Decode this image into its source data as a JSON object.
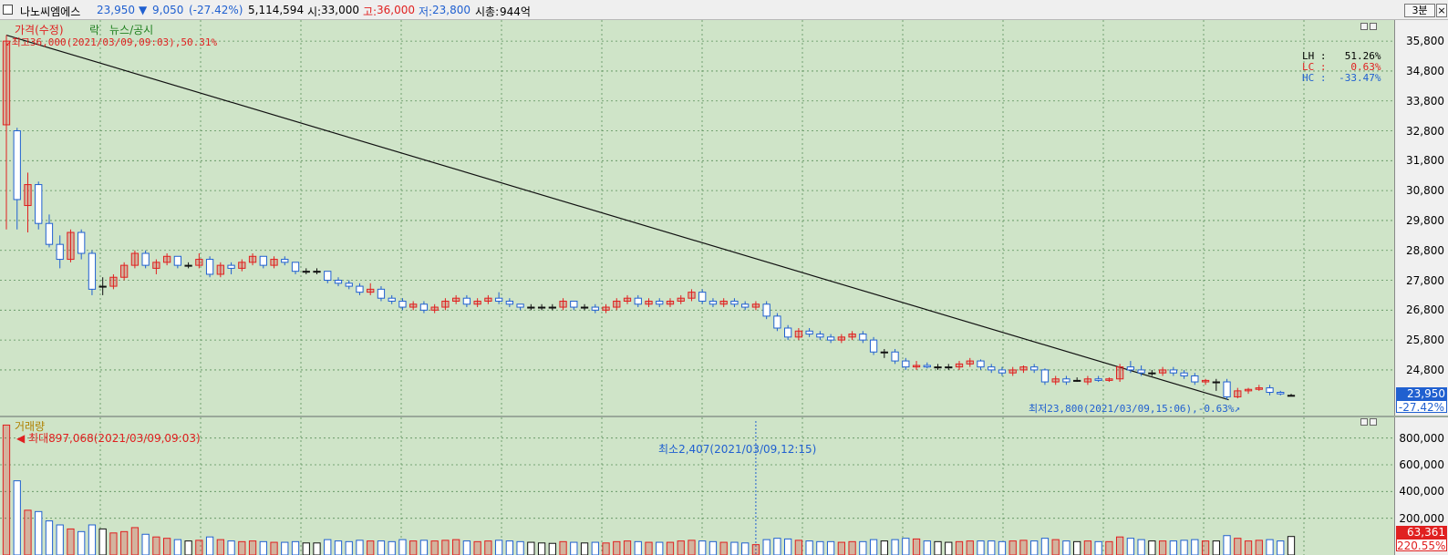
{
  "header": {
    "stock_name": "나노씨엠에스",
    "price": "23,950",
    "change_arrow": "▼",
    "change": "9,050",
    "change_pct": "(-27.42%)",
    "volume": "5,114,594",
    "open_label": "시:",
    "open": "33,000",
    "high_label": "고:",
    "high": "36,000",
    "low_label": "저:",
    "low": "23,800",
    "mcap_label": "시총:",
    "mcap": "944억",
    "period_button": "3분",
    "close_button": "×",
    "color_up": "#e02020",
    "color_down": "#2060d0"
  },
  "price_pane": {
    "legend": [
      "가격(수정)",
      "락",
      "뉴스/공시"
    ],
    "max_annotation": "최고36,000(2021/03/09,09:03),50.31%",
    "min_annotation": "최저23,800(2021/03/09,15:06),-0.63%",
    "stats": {
      "lh_label": "LH :",
      "lh_value": "51.26%",
      "lc_label": "LC :",
      "lc_value": "0.63%",
      "hc_label": "HC :",
      "hc_value": "-33.47%"
    },
    "axis_ticks": [
      "35,800",
      "34,800",
      "33,800",
      "32,800",
      "31,800",
      "30,800",
      "29,800",
      "28,800",
      "27,800",
      "26,800",
      "25,800",
      "24,800"
    ],
    "current_price_badge": "23,950",
    "current_pct_badge": "-27.42%"
  },
  "volume_pane": {
    "legend": "거래량",
    "max_annotation": "최대897,068(2021/03/09,09:03)",
    "min_annotation": "최소2,407(2021/03/09,12:15)",
    "axis_ticks": [
      "800,000",
      "600,000",
      "400,000",
      "200,000"
    ],
    "current_volume_badge": "63,361",
    "badge_pct": "220.55%"
  },
  "chart_data": {
    "type": "candlestick",
    "interval": "3분",
    "y_range": [
      23700,
      36200
    ],
    "volume_range": [
      0,
      900000
    ],
    "candles": [
      {
        "o": 33000,
        "h": 36000,
        "l": 29500,
        "c": 35800,
        "v": 897068
      },
      {
        "o": 32800,
        "h": 32900,
        "l": 29500,
        "c": 30500,
        "v": 480000
      },
      {
        "o": 30300,
        "h": 31400,
        "l": 29400,
        "c": 31000,
        "v": 260000
      },
      {
        "o": 31000,
        "h": 31100,
        "l": 29500,
        "c": 29700,
        "v": 250000
      },
      {
        "o": 29700,
        "h": 30000,
        "l": 28900,
        "c": 29000,
        "v": 180000
      },
      {
        "o": 29000,
        "h": 29300,
        "l": 28200,
        "c": 28500,
        "v": 150000
      },
      {
        "o": 28500,
        "h": 29500,
        "l": 28400,
        "c": 29400,
        "v": 120000
      },
      {
        "o": 29400,
        "h": 29500,
        "l": 28500,
        "c": 28700,
        "v": 100000
      },
      {
        "o": 28700,
        "h": 28800,
        "l": 27300,
        "c": 27500,
        "v": 150000
      },
      {
        "o": 27600,
        "h": 27900,
        "l": 27300,
        "c": 27600,
        "v": 120000
      },
      {
        "o": 27600,
        "h": 28000,
        "l": 27500,
        "c": 27900,
        "v": 90000
      },
      {
        "o": 27900,
        "h": 28400,
        "l": 27800,
        "c": 28300,
        "v": 100000
      },
      {
        "o": 28300,
        "h": 28800,
        "l": 28200,
        "c": 28700,
        "v": 130000
      },
      {
        "o": 28700,
        "h": 28800,
        "l": 28200,
        "c": 28300,
        "v": 80000
      },
      {
        "o": 28200,
        "h": 28500,
        "l": 28000,
        "c": 28400,
        "v": 60000
      },
      {
        "o": 28400,
        "h": 28700,
        "l": 28300,
        "c": 28600,
        "v": 50000
      },
      {
        "o": 28600,
        "h": 28600,
        "l": 28200,
        "c": 28300,
        "v": 40000
      },
      {
        "o": 28300,
        "h": 28400,
        "l": 28200,
        "c": 28300,
        "v": 30000
      },
      {
        "o": 28300,
        "h": 28700,
        "l": 28200,
        "c": 28500,
        "v": 35000
      },
      {
        "o": 28500,
        "h": 28600,
        "l": 27900,
        "c": 28000,
        "v": 60000
      },
      {
        "o": 28000,
        "h": 28400,
        "l": 27900,
        "c": 28300,
        "v": 40000
      },
      {
        "o": 28300,
        "h": 28400,
        "l": 28000,
        "c": 28200,
        "v": 30000
      },
      {
        "o": 28200,
        "h": 28500,
        "l": 28100,
        "c": 28400,
        "v": 25000
      },
      {
        "o": 28400,
        "h": 28700,
        "l": 28300,
        "c": 28600,
        "v": 30000
      },
      {
        "o": 28600,
        "h": 28600,
        "l": 28200,
        "c": 28300,
        "v": 25000
      },
      {
        "o": 28300,
        "h": 28600,
        "l": 28200,
        "c": 28500,
        "v": 20000
      },
      {
        "o": 28500,
        "h": 28600,
        "l": 28300,
        "c": 28400,
        "v": 20000
      },
      {
        "o": 28400,
        "h": 28400,
        "l": 28000,
        "c": 28100,
        "v": 25000
      },
      {
        "o": 28100,
        "h": 28200,
        "l": 28000,
        "c": 28100,
        "v": 15000
      },
      {
        "o": 28100,
        "h": 28200,
        "l": 28000,
        "c": 28100,
        "v": 15000
      },
      {
        "o": 28100,
        "h": 28100,
        "l": 27700,
        "c": 27800,
        "v": 40000
      },
      {
        "o": 27800,
        "h": 27900,
        "l": 27600,
        "c": 27700,
        "v": 30000
      },
      {
        "o": 27700,
        "h": 27800,
        "l": 27500,
        "c": 27600,
        "v": 25000
      },
      {
        "o": 27600,
        "h": 27700,
        "l": 27300,
        "c": 27400,
        "v": 35000
      },
      {
        "o": 27400,
        "h": 27700,
        "l": 27300,
        "c": 27500,
        "v": 30000
      },
      {
        "o": 27500,
        "h": 27600,
        "l": 27100,
        "c": 27200,
        "v": 30000
      },
      {
        "o": 27200,
        "h": 27300,
        "l": 27000,
        "c": 27100,
        "v": 25000
      },
      {
        "o": 27100,
        "h": 27200,
        "l": 26800,
        "c": 26900,
        "v": 40000
      },
      {
        "o": 26900,
        "h": 27100,
        "l": 26800,
        "c": 27000,
        "v": 30000
      },
      {
        "o": 27000,
        "h": 27100,
        "l": 26700,
        "c": 26800,
        "v": 35000
      },
      {
        "o": 26800,
        "h": 27000,
        "l": 26700,
        "c": 26900,
        "v": 30000
      },
      {
        "o": 26900,
        "h": 27200,
        "l": 26800,
        "c": 27100,
        "v": 35000
      },
      {
        "o": 27100,
        "h": 27300,
        "l": 27000,
        "c": 27200,
        "v": 40000
      },
      {
        "o": 27200,
        "h": 27300,
        "l": 26900,
        "c": 27000,
        "v": 30000
      },
      {
        "o": 27000,
        "h": 27200,
        "l": 26900,
        "c": 27100,
        "v": 25000
      },
      {
        "o": 27100,
        "h": 27300,
        "l": 27000,
        "c": 27200,
        "v": 30000
      },
      {
        "o": 27200,
        "h": 27400,
        "l": 27000,
        "c": 27100,
        "v": 35000
      },
      {
        "o": 27100,
        "h": 27200,
        "l": 26900,
        "c": 27000,
        "v": 30000
      },
      {
        "o": 27000,
        "h": 27000,
        "l": 26800,
        "c": 26900,
        "v": 25000
      },
      {
        "o": 26900,
        "h": 27000,
        "l": 26800,
        "c": 26900,
        "v": 20000
      },
      {
        "o": 26900,
        "h": 27000,
        "l": 26800,
        "c": 26900,
        "v": 15000
      },
      {
        "o": 26900,
        "h": 27000,
        "l": 26800,
        "c": 26900,
        "v": 12000
      },
      {
        "o": 26900,
        "h": 27200,
        "l": 26800,
        "c": 27100,
        "v": 25000
      },
      {
        "o": 27100,
        "h": 27100,
        "l": 26800,
        "c": 26900,
        "v": 20000
      },
      {
        "o": 26900,
        "h": 27000,
        "l": 26800,
        "c": 26900,
        "v": 15000
      },
      {
        "o": 26900,
        "h": 27000,
        "l": 26700,
        "c": 26800,
        "v": 20000
      },
      {
        "o": 26800,
        "h": 27000,
        "l": 26700,
        "c": 26900,
        "v": 15000
      },
      {
        "o": 26900,
        "h": 27200,
        "l": 26800,
        "c": 27100,
        "v": 25000
      },
      {
        "o": 27100,
        "h": 27300,
        "l": 27000,
        "c": 27200,
        "v": 30000
      },
      {
        "o": 27200,
        "h": 27300,
        "l": 26900,
        "c": 27000,
        "v": 25000
      },
      {
        "o": 27000,
        "h": 27200,
        "l": 26900,
        "c": 27100,
        "v": 20000
      },
      {
        "o": 27100,
        "h": 27200,
        "l": 26900,
        "c": 27000,
        "v": 20000
      },
      {
        "o": 27000,
        "h": 27200,
        "l": 26900,
        "c": 27100,
        "v": 20000
      },
      {
        "o": 27100,
        "h": 27300,
        "l": 27000,
        "c": 27200,
        "v": 30000
      },
      {
        "o": 27200,
        "h": 27500,
        "l": 27100,
        "c": 27400,
        "v": 35000
      },
      {
        "o": 27400,
        "h": 27500,
        "l": 27000,
        "c": 27100,
        "v": 30000
      },
      {
        "o": 27100,
        "h": 27200,
        "l": 26900,
        "c": 27000,
        "v": 25000
      },
      {
        "o": 27000,
        "h": 27200,
        "l": 26900,
        "c": 27100,
        "v": 20000
      },
      {
        "o": 27100,
        "h": 27200,
        "l": 26900,
        "c": 27000,
        "v": 20000
      },
      {
        "o": 27000,
        "h": 27100,
        "l": 26800,
        "c": 26900,
        "v": 15000
      },
      {
        "o": 26900,
        "h": 27100,
        "l": 26800,
        "c": 27000,
        "v": 2407
      },
      {
        "o": 27000,
        "h": 27100,
        "l": 26500,
        "c": 26600,
        "v": 40000
      },
      {
        "o": 26600,
        "h": 26700,
        "l": 26100,
        "c": 26200,
        "v": 50000
      },
      {
        "o": 26200,
        "h": 26300,
        "l": 25800,
        "c": 25900,
        "v": 45000
      },
      {
        "o": 25900,
        "h": 26200,
        "l": 25800,
        "c": 26100,
        "v": 35000
      },
      {
        "o": 26100,
        "h": 26200,
        "l": 25900,
        "c": 26000,
        "v": 30000
      },
      {
        "o": 26000,
        "h": 26100,
        "l": 25800,
        "c": 25900,
        "v": 25000
      },
      {
        "o": 25900,
        "h": 26000,
        "l": 25700,
        "c": 25800,
        "v": 25000
      },
      {
        "o": 25800,
        "h": 26000,
        "l": 25700,
        "c": 25900,
        "v": 20000
      },
      {
        "o": 25900,
        "h": 26100,
        "l": 25800,
        "c": 26000,
        "v": 25000
      },
      {
        "o": 26000,
        "h": 26100,
        "l": 25700,
        "c": 25800,
        "v": 25000
      },
      {
        "o": 25800,
        "h": 25900,
        "l": 25300,
        "c": 25400,
        "v": 40000
      },
      {
        "o": 25400,
        "h": 25500,
        "l": 25200,
        "c": 25400,
        "v": 30000
      },
      {
        "o": 25400,
        "h": 25500,
        "l": 25000,
        "c": 25100,
        "v": 40000
      },
      {
        "o": 25100,
        "h": 25200,
        "l": 24800,
        "c": 24900,
        "v": 50000
      },
      {
        "o": 24900,
        "h": 25100,
        "l": 24800,
        "c": 24950,
        "v": 45000
      },
      {
        "o": 24950,
        "h": 25050,
        "l": 24850,
        "c": 24900,
        "v": 30000
      },
      {
        "o": 24900,
        "h": 25000,
        "l": 24800,
        "c": 24900,
        "v": 25000
      },
      {
        "o": 24900,
        "h": 25000,
        "l": 24800,
        "c": 24900,
        "v": 20000
      },
      {
        "o": 24900,
        "h": 25100,
        "l": 24800,
        "c": 25000,
        "v": 25000
      },
      {
        "o": 25000,
        "h": 25200,
        "l": 24900,
        "c": 25100,
        "v": 30000
      },
      {
        "o": 25100,
        "h": 25150,
        "l": 24800,
        "c": 24900,
        "v": 30000
      },
      {
        "o": 24900,
        "h": 25000,
        "l": 24700,
        "c": 24800,
        "v": 30000
      },
      {
        "o": 24800,
        "h": 24900,
        "l": 24600,
        "c": 24700,
        "v": 25000
      },
      {
        "o": 24700,
        "h": 24900,
        "l": 24600,
        "c": 24800,
        "v": 30000
      },
      {
        "o": 24800,
        "h": 24950,
        "l": 24700,
        "c": 24900,
        "v": 35000
      },
      {
        "o": 24900,
        "h": 25000,
        "l": 24700,
        "c": 24800,
        "v": 30000
      },
      {
        "o": 24800,
        "h": 24850,
        "l": 24300,
        "c": 24400,
        "v": 50000
      },
      {
        "o": 24400,
        "h": 24600,
        "l": 24300,
        "c": 24500,
        "v": 40000
      },
      {
        "o": 24500,
        "h": 24600,
        "l": 24300,
        "c": 24400,
        "v": 30000
      },
      {
        "o": 24450,
        "h": 24550,
        "l": 24400,
        "c": 24450,
        "v": 25000
      },
      {
        "o": 24400,
        "h": 24600,
        "l": 24300,
        "c": 24500,
        "v": 30000
      },
      {
        "o": 24500,
        "h": 24600,
        "l": 24400,
        "c": 24450,
        "v": 25000
      },
      {
        "o": 24450,
        "h": 24550,
        "l": 24400,
        "c": 24500,
        "v": 25000
      },
      {
        "o": 24500,
        "h": 25000,
        "l": 24400,
        "c": 24900,
        "v": 60000
      },
      {
        "o": 24900,
        "h": 25100,
        "l": 24700,
        "c": 24800,
        "v": 50000
      },
      {
        "o": 24800,
        "h": 24950,
        "l": 24600,
        "c": 24700,
        "v": 40000
      },
      {
        "o": 24700,
        "h": 24800,
        "l": 24600,
        "c": 24700,
        "v": 30000
      },
      {
        "o": 24700,
        "h": 24900,
        "l": 24600,
        "c": 24800,
        "v": 30000
      },
      {
        "o": 24800,
        "h": 24900,
        "l": 24600,
        "c": 24700,
        "v": 30000
      },
      {
        "o": 24700,
        "h": 24800,
        "l": 24500,
        "c": 24600,
        "v": 35000
      },
      {
        "o": 24600,
        "h": 24700,
        "l": 24300,
        "c": 24400,
        "v": 40000
      },
      {
        "o": 24400,
        "h": 24500,
        "l": 24300,
        "c": 24450,
        "v": 30000
      },
      {
        "o": 24400,
        "h": 24500,
        "l": 24100,
        "c": 24400,
        "v": 30000
      },
      {
        "o": 24400,
        "h": 24500,
        "l": 23800,
        "c": 23900,
        "v": 70000
      },
      {
        "o": 23900,
        "h": 24200,
        "l": 23850,
        "c": 24100,
        "v": 50000
      },
      {
        "o": 24100,
        "h": 24200,
        "l": 24000,
        "c": 24150,
        "v": 30000
      },
      {
        "o": 24150,
        "h": 24300,
        "l": 24100,
        "c": 24200,
        "v": 35000
      },
      {
        "o": 24200,
        "h": 24300,
        "l": 23950,
        "c": 24050,
        "v": 40000
      },
      {
        "o": 24050,
        "h": 24100,
        "l": 23950,
        "c": 24000,
        "v": 30000
      },
      {
        "o": 23950,
        "h": 24000,
        "l": 23950,
        "c": 23950,
        "v": 63361
      }
    ]
  }
}
